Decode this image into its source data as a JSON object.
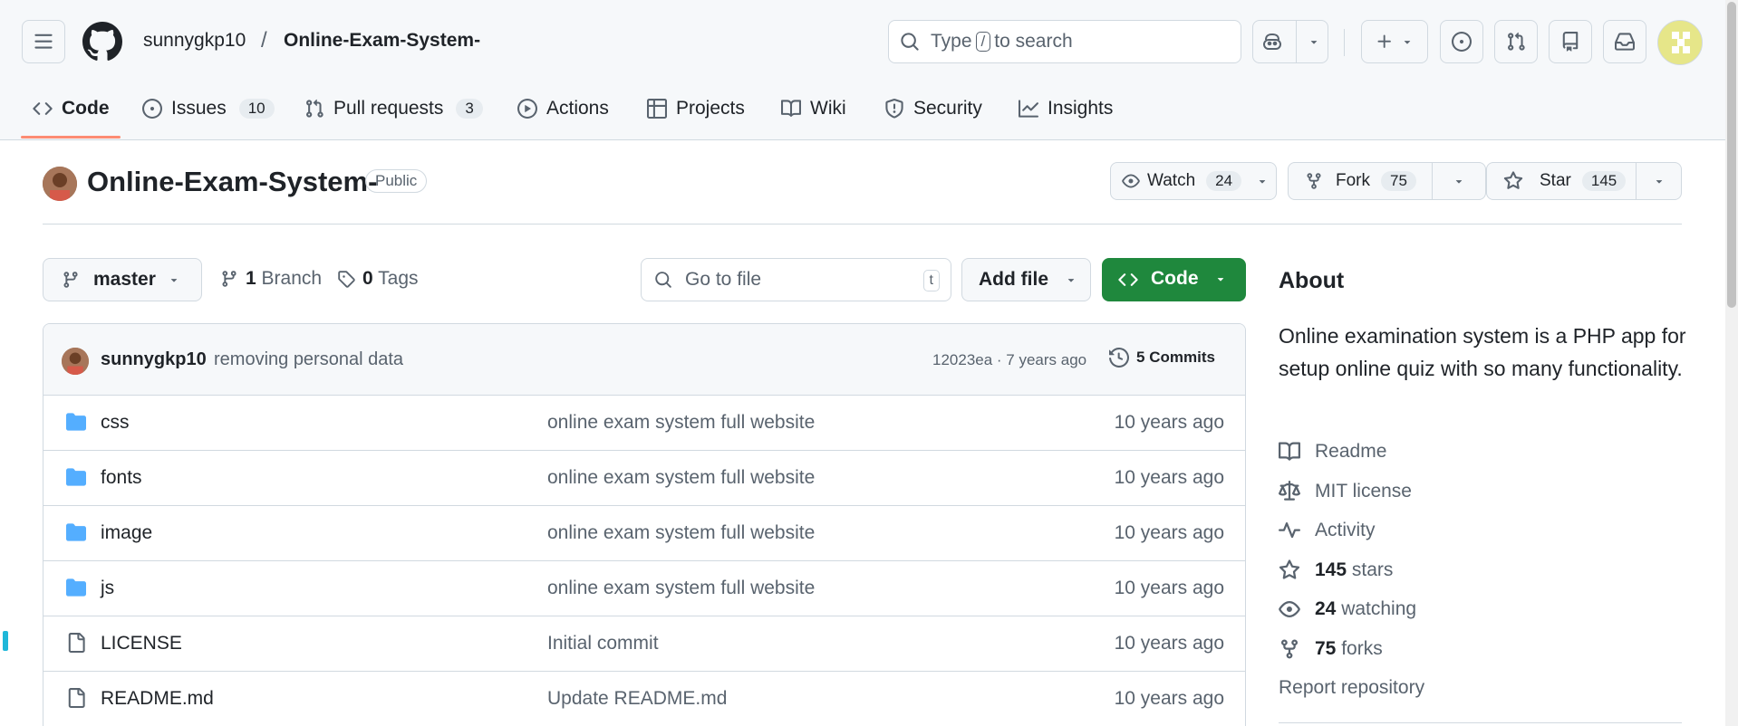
{
  "header": {
    "owner": "sunnygkp10",
    "separator": "/",
    "repo": "Online-Exam-System-",
    "search_prefix": "Type",
    "search_key": "/",
    "search_suffix": "to search"
  },
  "tabs": [
    {
      "label": "Code",
      "count": ""
    },
    {
      "label": "Issues",
      "count": "10"
    },
    {
      "label": "Pull requests",
      "count": "3"
    },
    {
      "label": "Actions",
      "count": ""
    },
    {
      "label": "Projects",
      "count": ""
    },
    {
      "label": "Wiki",
      "count": ""
    },
    {
      "label": "Security",
      "count": ""
    },
    {
      "label": "Insights",
      "count": ""
    }
  ],
  "repo_header": {
    "title": "Online-Exam-System-",
    "visibility": "Public",
    "watch_label": "Watch",
    "watch_count": "24",
    "fork_label": "Fork",
    "fork_count": "75",
    "star_label": "Star",
    "star_count": "145"
  },
  "toolbar": {
    "branch": "master",
    "branches_count": "1",
    "branches_label": "Branch",
    "tags_count": "0",
    "tags_label": "Tags",
    "goto_placeholder": "Go to file",
    "goto_key": "t",
    "add_file": "Add file",
    "code": "Code"
  },
  "latest_commit": {
    "author": "sunnygkp10",
    "message": "removing personal data",
    "hash_age": "12023ea · 7 years ago",
    "commits_count": "5",
    "commits_label": "Commits"
  },
  "files": [
    {
      "name": "css",
      "type": "folder",
      "message": "online exam system full website",
      "age": "10 years ago"
    },
    {
      "name": "fonts",
      "type": "folder",
      "message": "online exam system full website",
      "age": "10 years ago"
    },
    {
      "name": "image",
      "type": "folder",
      "message": "online exam system full website",
      "age": "10 years ago"
    },
    {
      "name": "js",
      "type": "folder",
      "message": "online exam system full website",
      "age": "10 years ago"
    },
    {
      "name": "LICENSE",
      "type": "file",
      "message": "Initial commit",
      "age": "10 years ago"
    },
    {
      "name": "README.md",
      "type": "file",
      "message": "Update README.md",
      "age": "10 years ago"
    }
  ],
  "about": {
    "heading": "About",
    "description": "Online examination system is a PHP app for setup online quiz with so many functionality.",
    "readme": "Readme",
    "license": "MIT license",
    "activity": "Activity",
    "stars_count": "145",
    "stars_label": "stars",
    "watching_count": "24",
    "watching_label": "watching",
    "forks_count": "75",
    "forks_label": "forks",
    "report": "Report repository"
  },
  "colors": {
    "accent_green": "#1f883d",
    "tab_underline": "#fd8c73",
    "folder_blue": "#54aeff",
    "muted": "#59636e"
  }
}
